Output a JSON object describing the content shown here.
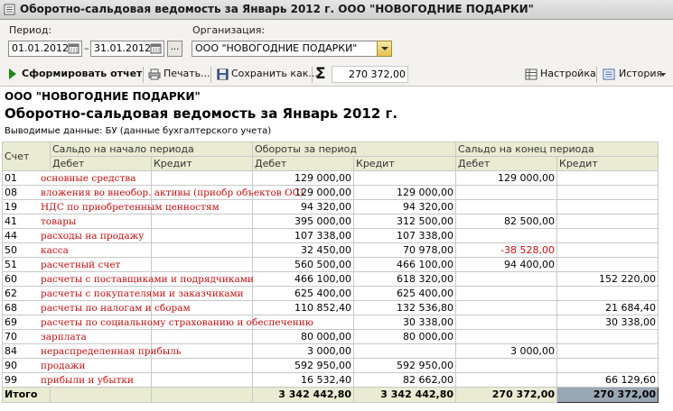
{
  "window": {
    "title": "Оборотно-сальдовая ведомость за Январь 2012 г. ООО \"НОВОГОДНИЕ ПОДАРКИ\""
  },
  "params": {
    "period_label": "Период:",
    "date_from": "01.01.2012",
    "dash": "–",
    "date_to": "31.01.2012",
    "dots": "...",
    "org_label": "Организация:",
    "org_value": "ООО \"НОВОГОДНИЕ ПОДАРКИ\""
  },
  "toolbar": {
    "generate": "Сформировать отчет",
    "print": "Печать...",
    "save": "Сохранить как...",
    "sigma": "Σ",
    "sum": "270 372,00",
    "settings": "Настройка",
    "history": "История"
  },
  "report": {
    "org": "ООО \"НОВОГОДНИЕ ПОДАРКИ\"",
    "title": "Оборотно-сальдовая ведомость за Январь 2012 г.",
    "data_shown": "Выводимые данные:  БУ (данные бухгалтерского учета)",
    "headers": {
      "account": "Счет",
      "opening": "Сальдо на начало периода",
      "turnover": "Обороты за период",
      "closing": "Сальдо на конец периода",
      "debit": "Дебет",
      "credit": "Кредит"
    },
    "rows": [
      {
        "code": "01",
        "name": "основные средства",
        "ob_debit": "129 000,00",
        "ob_credit": "",
        "t_debit": "",
        "t_credit": "",
        "cb_debit": "129 000,00",
        "cb_credit": ""
      },
      {
        "code": "08",
        "name": "вложения во внеобор. активы (приобр объектов ОС)",
        "ob_debit": "129 000,00",
        "ob_credit": "",
        "t_debit": "",
        "t_credit": "129 000,00",
        "cb_debit": "",
        "cb_credit": ""
      },
      {
        "code": "19",
        "name": "НДС по приобретенным ценностям",
        "ob_debit": "94 320,00",
        "ob_credit": "",
        "t_debit": "",
        "t_credit": "94 320,00",
        "cb_debit": "",
        "cb_credit": ""
      },
      {
        "code": "41",
        "name": "товары",
        "ob_debit": "395 000,00",
        "ob_credit": "",
        "t_debit": "",
        "t_credit": "312 500,00",
        "cb_debit": "82 500,00",
        "cb_credit": ""
      },
      {
        "code": "44",
        "name": "расходы на продажу",
        "ob_debit": "107 338,00",
        "ob_credit": "",
        "t_debit": "",
        "t_credit": "107 338,00",
        "cb_debit": "",
        "cb_credit": ""
      },
      {
        "code": "50",
        "name": "касса",
        "ob_debit": "32 450,00",
        "ob_credit": "",
        "t_debit": "",
        "t_credit": "70 978,00",
        "cb_debit": "-38 528,00",
        "cb_credit": ""
      },
      {
        "code": "51",
        "name": "расчетный счет",
        "ob_debit": "560 500,00",
        "ob_credit": "",
        "t_debit": "",
        "t_credit": "466 100,00",
        "cb_debit": "94 400,00",
        "cb_credit": ""
      },
      {
        "code": "60",
        "name": "расчеты с поставщиками и подрядчиками",
        "ob_debit": "466 100,00",
        "ob_credit": "",
        "t_debit": "",
        "t_credit": "618 320,00",
        "cb_debit": "",
        "cb_credit": "152 220,00"
      },
      {
        "code": "62",
        "name": "расчеты с покупателями и заказчиками",
        "ob_debit": "625 400,00",
        "ob_credit": "",
        "t_debit": "",
        "t_credit": "625 400,00",
        "cb_debit": "",
        "cb_credit": ""
      },
      {
        "code": "68",
        "name": "расчеты по налогам и сборам",
        "ob_debit": "110 852,40",
        "ob_credit": "",
        "t_debit": "",
        "t_credit": "132 536,80",
        "cb_debit": "",
        "cb_credit": "21 684,40"
      },
      {
        "code": "69",
        "name": "расчеты по социальному страхованию и обеспечению",
        "ob_debit": "",
        "ob_credit": "",
        "t_debit": "",
        "t_credit": "30 338,00",
        "cb_debit": "",
        "cb_credit": "30 338,00"
      },
      {
        "code": "70",
        "name": "зарплата",
        "ob_debit": "80 000,00",
        "ob_credit": "",
        "t_debit": "",
        "t_credit": "80 000,00",
        "cb_debit": "",
        "cb_credit": ""
      },
      {
        "code": "84",
        "name": "нераспределенная прибыль",
        "ob_debit": "3 000,00",
        "ob_credit": "",
        "t_debit": "",
        "t_credit": "",
        "cb_debit": "3 000,00",
        "cb_credit": ""
      },
      {
        "code": "90",
        "name": "продажи",
        "ob_debit": "592 950,00",
        "ob_credit": "",
        "t_debit": "",
        "t_credit": "592 950,00",
        "cb_debit": "",
        "cb_credit": ""
      },
      {
        "code": "99",
        "name": "прибыли и убытки",
        "ob_debit": "16 532,40",
        "ob_credit": "",
        "t_debit": "",
        "t_credit": "82 662,00",
        "cb_debit": "",
        "cb_credit": "66 129,60"
      }
    ],
    "total": {
      "label": "Итого",
      "t_debit": "3 342 442,80",
      "t_credit": "3 342 442,80",
      "cb_debit": "270 372,00",
      "cb_credit": "270 372,00"
    }
  }
}
